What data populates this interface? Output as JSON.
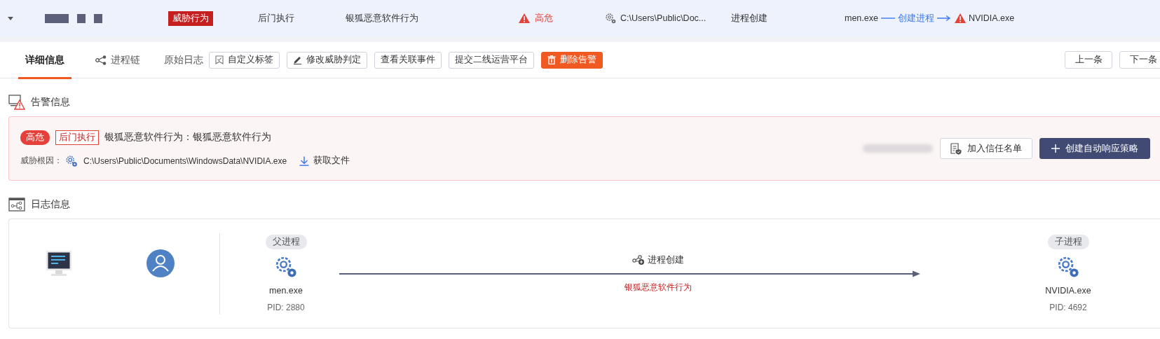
{
  "alert_row": {
    "expanded": true,
    "category": "威胁行为",
    "technique": "后门执行",
    "name": "银狐恶意软件行为",
    "severity": "高危",
    "path": "C:\\Users\\Public\\Doc...",
    "action": "进程创建",
    "chain": {
      "parent": "men.exe",
      "verb": "创建进程",
      "child": "NVIDIA.exe"
    }
  },
  "tabs": [
    {
      "label": "详细信息",
      "selected": true,
      "kind": "text"
    },
    {
      "label": "进程链",
      "selected": false,
      "kind": "chain"
    },
    {
      "label": "原始日志",
      "selected": false,
      "kind": "text"
    }
  ],
  "toolbar_buttons": [
    {
      "label": "自定义标签",
      "kind": "tag"
    },
    {
      "label": "修改威胁判定",
      "kind": "edit"
    },
    {
      "label": "查看关联事件",
      "kind": "plain"
    },
    {
      "label": "提交二线运营平台",
      "kind": "plain"
    },
    {
      "label": "删除告警",
      "kind": "danger"
    }
  ],
  "nav_buttons": [
    "上一条",
    "下一条"
  ],
  "alert_info": {
    "title": "告警信息",
    "severity": "高危",
    "technique": "后门执行",
    "headline": "银狐恶意软件行为：银狐恶意软件行为",
    "root_label": "威胁根因：",
    "root_path": "C:\\Users\\Public\\Documents\\WindowsData\\NVIDIA.exe",
    "download": "获取文件",
    "buttons": [
      {
        "label": "加入信任名单",
        "kind": "trust"
      },
      {
        "label": "创建自动响应策略",
        "kind": "primary"
      }
    ]
  },
  "log_info": {
    "title": "日志信息",
    "parent": {
      "tag": "父进程",
      "name": "men.exe",
      "pid": "PID: 2880"
    },
    "edge": {
      "action": "进程创建",
      "behavior": "银狐恶意软件行为"
    },
    "child": {
      "tag": "子进程",
      "name": "NVIDIA.exe",
      "pid": "PID: 4692"
    }
  }
}
